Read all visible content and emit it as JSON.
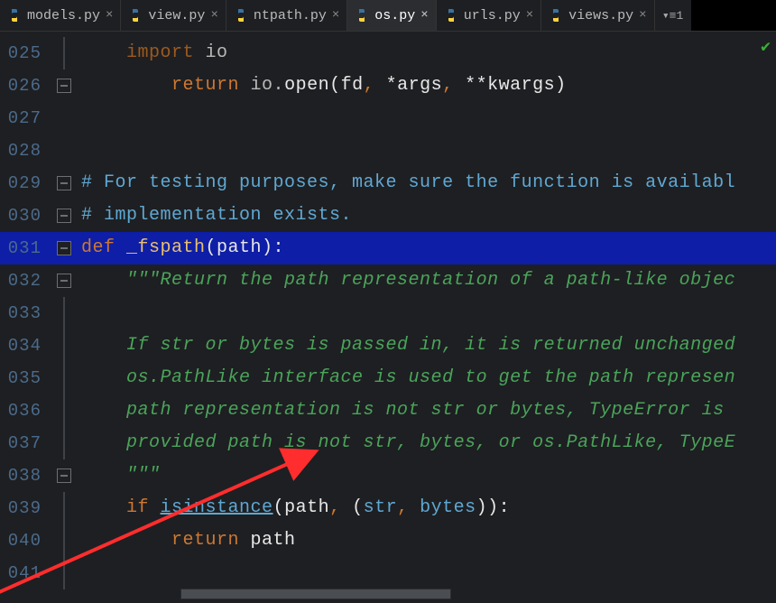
{
  "tabs": [
    {
      "label": "models.py",
      "active": false
    },
    {
      "label": "view.py",
      "active": false
    },
    {
      "label": "ntpath.py",
      "active": false
    },
    {
      "label": "os.py",
      "active": true
    },
    {
      "label": "urls.py",
      "active": false
    },
    {
      "label": "views.py",
      "active": false
    }
  ],
  "overflow_indicator": "▾≡1",
  "line_numbers": [
    "025",
    "026",
    "027",
    "028",
    "029",
    "030",
    "031",
    "032",
    "033",
    "034",
    "035",
    "036",
    "037",
    "038",
    "039",
    "040",
    "041"
  ],
  "code": {
    "l025": {
      "kw": "import",
      "rest": " io"
    },
    "l026": {
      "pre": "        ",
      "kw": "return ",
      "mod": "io",
      "dot": ".",
      "fn": "open",
      "args1": "(fd",
      "comma1": ",",
      "args2": " *args",
      "comma2": ",",
      "args3": " **kwargs)"
    },
    "l029": "# For testing purposes, make sure the function is availabl",
    "l030": "# implementation exists.",
    "l031": {
      "kw": "def ",
      "name": "_fspath",
      "sig": "(path):"
    },
    "l032": "    \"\"\"Return the path representation of a path-like objec",
    "l034": "    If str or bytes is passed in, it is returned unchanged",
    "l035": "    os.PathLike interface is used to get the path represen",
    "l036": "    path representation is not str or bytes, TypeError is ",
    "l037": "    provided path is not str, bytes, or os.PathLike, TypeE",
    "l038": "    \"\"\"",
    "l039": {
      "pre": "    ",
      "kw": "if ",
      "fn": "isinstance",
      "args": "(path",
      "comma1": ",",
      "rest1": " (",
      "b1": "str",
      "comma2": ",",
      "rest2": " ",
      "b2": "bytes",
      "close": ")):"
    },
    "l040": {
      "pre": "        ",
      "kw": "return ",
      "rest": "path"
    }
  }
}
